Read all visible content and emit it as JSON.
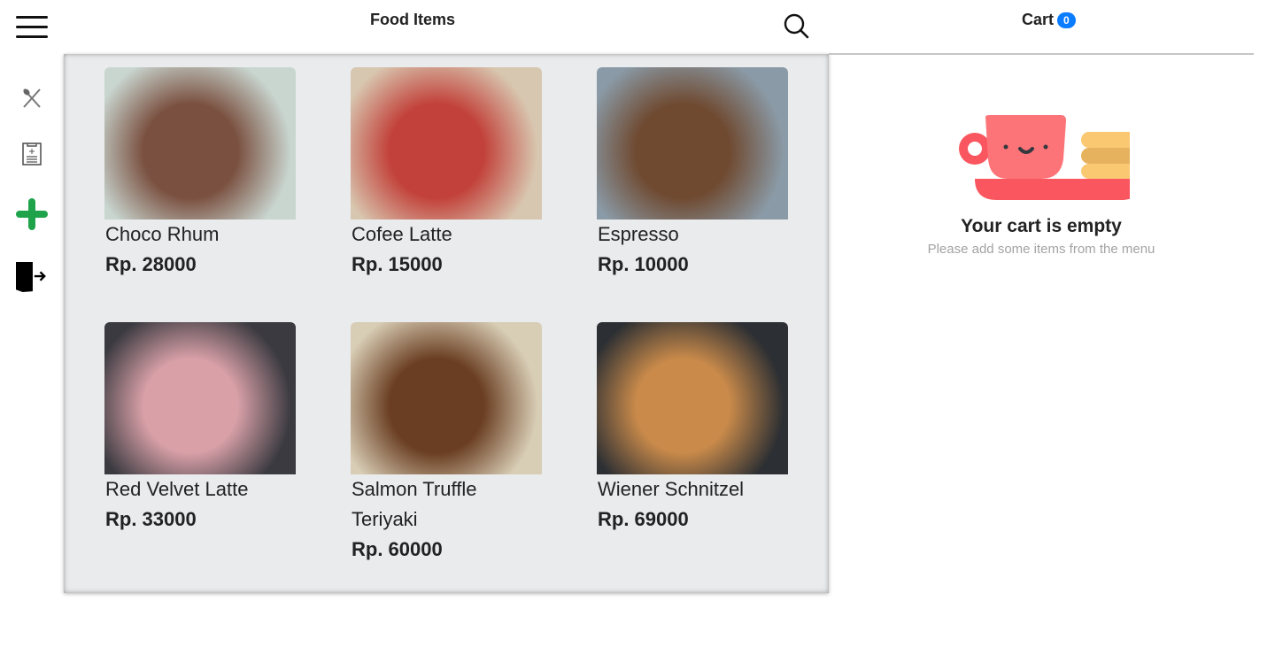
{
  "header": {
    "title": "Food Items",
    "cart_label": "Cart",
    "cart_count": "0"
  },
  "sidebar": {
    "items": [
      {
        "icon": "utensils-icon"
      },
      {
        "icon": "clipboard-icon"
      },
      {
        "icon": "plus-icon"
      },
      {
        "icon": "logout-icon"
      }
    ]
  },
  "items": [
    {
      "name": "Choco Rhum",
      "price": "Rp. 28000",
      "colors": [
        "#7a5040",
        "#c9d6d0"
      ]
    },
    {
      "name": "Cofee Latte",
      "price": "Rp. 15000",
      "colors": [
        "#c2413a",
        "#d8c7b0"
      ]
    },
    {
      "name": "Espresso",
      "price": "Rp. 10000",
      "colors": [
        "#6f4a31",
        "#8a9aa6"
      ]
    },
    {
      "name": "Red Velvet Latte",
      "price": "Rp. 33000",
      "colors": [
        "#d9a0a8",
        "#3a3a40"
      ]
    },
    {
      "name": "Salmon Truffle Teriyaki",
      "price": "Rp. 60000",
      "colors": [
        "#6a3e22",
        "#d8cdb5"
      ]
    },
    {
      "name": "Wiener Schnitzel",
      "price": "Rp. 69000",
      "colors": [
        "#c98a4a",
        "#2c2f33"
      ]
    }
  ],
  "cart": {
    "empty_title": "Your cart is empty",
    "empty_subtitle": "Please add some items from the menu"
  },
  "colors": {
    "accent": "#0a7cff",
    "plus": "#1fa34a",
    "panel": "#e9ebed"
  }
}
